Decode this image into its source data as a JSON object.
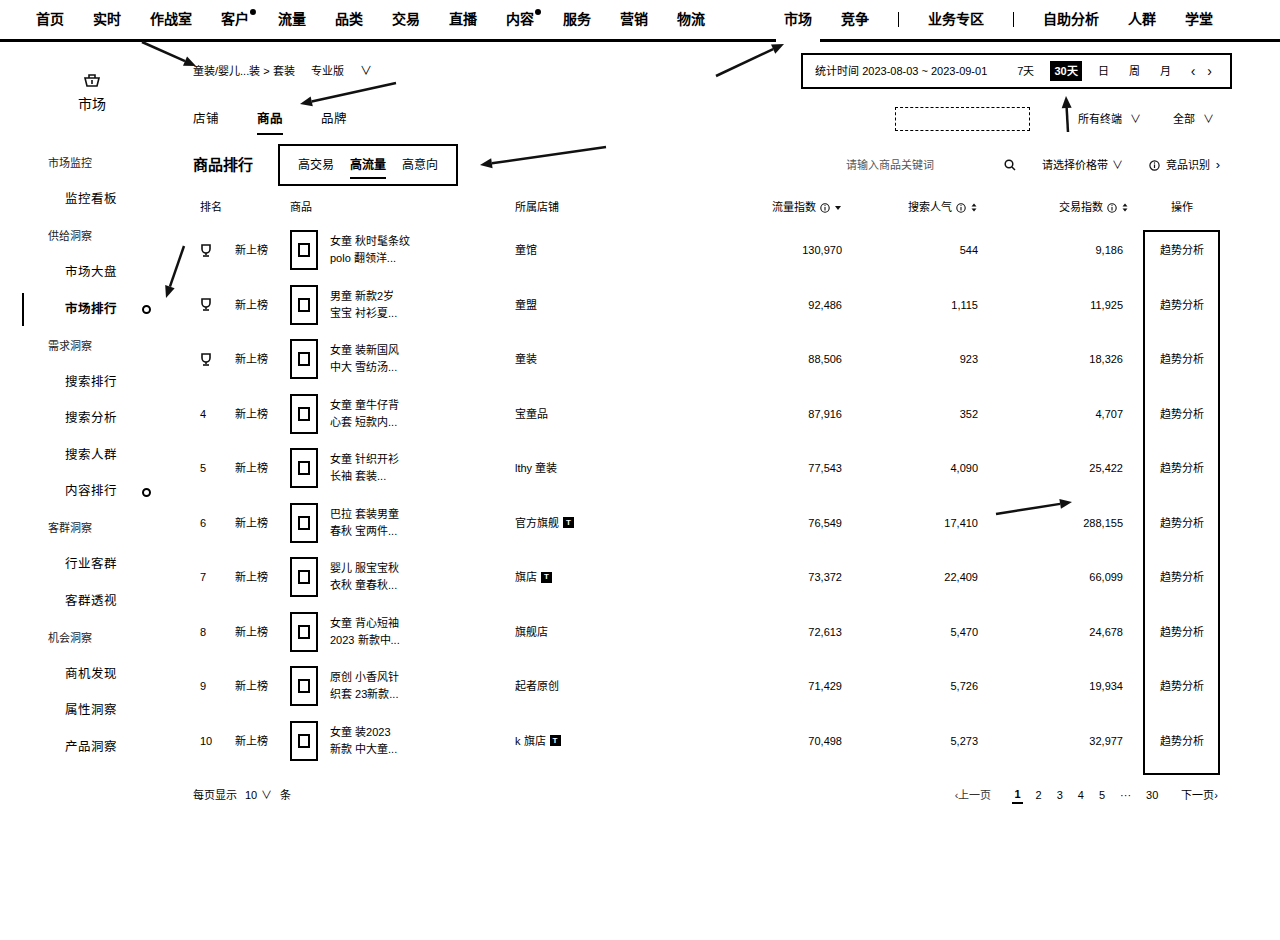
{
  "nav": [
    {
      "kind": "link",
      "label": "首页",
      "dot": false,
      "selected": false
    },
    {
      "kind": "link",
      "label": "实时",
      "dot": false,
      "selected": false
    },
    {
      "kind": "link",
      "label": "作战室",
      "dot": false,
      "selected": false
    },
    {
      "kind": "link",
      "label": "客户",
      "dot": true,
      "selected": false
    },
    {
      "kind": "link",
      "label": "流量",
      "dot": false,
      "selected": false
    },
    {
      "kind": "link",
      "label": "品类",
      "dot": false,
      "selected": false
    },
    {
      "kind": "link",
      "label": "交易",
      "dot": false,
      "selected": false
    },
    {
      "kind": "link",
      "label": "直播",
      "dot": false,
      "selected": false
    },
    {
      "kind": "link",
      "label": "内容",
      "dot": true,
      "selected": false
    },
    {
      "kind": "link",
      "label": "服务",
      "dot": false,
      "selected": false
    },
    {
      "kind": "link",
      "label": "营销",
      "dot": false,
      "selected": false
    },
    {
      "kind": "link",
      "label": "物流",
      "dot": false,
      "selected": false
    },
    {
      "kind": "link",
      "label": "市场",
      "dot": false,
      "selected": true
    },
    {
      "kind": "link",
      "label": "竞争",
      "dot": false,
      "selected": false
    },
    {
      "kind": "divider"
    },
    {
      "kind": "link",
      "label": "业务专区",
      "dot": false,
      "selected": false
    },
    {
      "kind": "divider"
    },
    {
      "kind": "link",
      "label": "自助分析",
      "dot": false,
      "selected": false
    },
    {
      "kind": "link",
      "label": "人群",
      "dot": false,
      "selected": false
    },
    {
      "kind": "link",
      "label": "学堂",
      "dot": false,
      "selected": false
    }
  ],
  "sidebar": {
    "title": "市场",
    "groups": [
      {
        "label": "市场监控",
        "items": [
          {
            "label": "监控看板",
            "selected": false,
            "marked": false
          }
        ]
      },
      {
        "label": "供给洞察",
        "items": [
          {
            "label": "市场大盘",
            "selected": false,
            "marked": false
          },
          {
            "label": "市场排行",
            "selected": true,
            "marked": true
          }
        ]
      },
      {
        "label": "需求洞察",
        "items": [
          {
            "label": "搜索排行",
            "selected": false,
            "marked": false
          },
          {
            "label": "搜索分析",
            "selected": false,
            "marked": false
          },
          {
            "label": "搜索人群",
            "selected": false,
            "marked": false
          },
          {
            "label": "内容排行",
            "selected": false,
            "marked": true
          }
        ]
      },
      {
        "label": "客群洞察",
        "items": [
          {
            "label": "行业客群",
            "selected": false,
            "marked": false
          },
          {
            "label": "客群透视",
            "selected": false,
            "marked": false
          }
        ]
      },
      {
        "label": "机会洞察",
        "items": [
          {
            "label": "商机发现",
            "selected": false,
            "marked": false
          },
          {
            "label": "属性洞察",
            "selected": false,
            "marked": false
          },
          {
            "label": "产品洞察",
            "selected": false,
            "marked": false
          }
        ]
      }
    ]
  },
  "breadcrumb": {
    "path": "童装/婴儿...装 > 套装",
    "edition": "专业版",
    "caret": "∨"
  },
  "date": {
    "label": "统计时间 2023-08-03 ~ 2023-09-01",
    "options": [
      {
        "label": "7天",
        "selected": false
      },
      {
        "label": "30天",
        "selected": true
      },
      {
        "label": "日",
        "selected": false
      },
      {
        "label": "周",
        "selected": false
      },
      {
        "label": "月",
        "selected": false
      }
    ],
    "prev": "‹",
    "next": "›"
  },
  "view_tabs": [
    {
      "label": "店铺",
      "selected": false
    },
    {
      "label": "商品",
      "selected": true
    },
    {
      "label": "品牌",
      "selected": false
    }
  ],
  "filters": {
    "terminal": "所有终端",
    "terminal_caret": "∨",
    "scope": "全部",
    "scope_caret": "∨"
  },
  "ranking": {
    "title": "商品排行",
    "tabs": [
      {
        "label": "高交易",
        "selected": false
      },
      {
        "label": "高流量",
        "selected": true
      },
      {
        "label": "高意向",
        "selected": false
      }
    ],
    "search_placeholder": "请输入商品关键词",
    "price": "请选择价格带",
    "price_caret": "∨",
    "competitor": "竞品识别",
    "competitor_arrow": "›"
  },
  "table": {
    "columns": [
      {
        "label": "排名",
        "info": false,
        "sort": "off"
      },
      {
        "label": "商品",
        "info": false,
        "sort": "off"
      },
      {
        "label": "所属店铺",
        "info": false,
        "sort": "off"
      },
      {
        "label": "流量指数",
        "info": true,
        "sort": "desc"
      },
      {
        "label": "搜索人气",
        "info": true,
        "sort": "none"
      },
      {
        "label": "交易指数",
        "info": true,
        "sort": "none"
      },
      {
        "label": "操作",
        "info": false,
        "sort": "off"
      }
    ],
    "rows": [
      {
        "kind": "trophy",
        "badge": "新上榜",
        "product": [
          "女童 秋时髦条纹",
          "polo 翻领洋..."
        ],
        "shop": "童馆",
        "shop_badge": "",
        "flow": "130,970",
        "search": "544",
        "trade": "9,186",
        "action": "趋势分析"
      },
      {
        "kind": "trophy",
        "badge": "新上榜",
        "product": [
          "男童 新款2岁",
          "宝宝 衬衫夏..."
        ],
        "shop": "童盟",
        "shop_badge": "",
        "flow": "92,486",
        "search": "1,115",
        "trade": "11,925",
        "action": "趋势分析"
      },
      {
        "kind": "trophy",
        "badge": "新上榜",
        "product": [
          "女童 装新国风",
          "中大 雪纺汤..."
        ],
        "shop": "童装",
        "shop_badge": "",
        "flow": "88,506",
        "search": "923",
        "trade": "18,326",
        "action": "趋势分析"
      },
      {
        "kind": "number",
        "rank": "4",
        "badge": "新上榜",
        "product": [
          "女童 童牛仔背",
          "心套 短款内..."
        ],
        "shop": "宝童品",
        "shop_badge": "",
        "flow": "87,916",
        "search": "352",
        "trade": "4,707",
        "action": "趋势分析"
      },
      {
        "kind": "number",
        "rank": "5",
        "badge": "新上榜",
        "product": [
          "女童 针织开衫",
          "长袖 套装..."
        ],
        "shop": "lthy 童装",
        "shop_badge": "",
        "flow": "77,543",
        "search": "4,090",
        "trade": "25,422",
        "action": "趋势分析"
      },
      {
        "kind": "number",
        "rank": "6",
        "badge": "新上榜",
        "product": [
          "巴拉 套装男童",
          "春秋 宝两件..."
        ],
        "shop": "官方旗舰",
        "shop_badge": "T",
        "flow": "76,549",
        "search": "17,410",
        "trade": "288,155",
        "action": "趋势分析"
      },
      {
        "kind": "number",
        "rank": "7",
        "badge": "新上榜",
        "product": [
          "婴儿 服宝宝秋",
          "衣秋 童春秋..."
        ],
        "shop": "旗店",
        "shop_badge": "T",
        "flow": "73,372",
        "search": "22,409",
        "trade": "66,099",
        "action": "趋势分析"
      },
      {
        "kind": "number",
        "rank": "8",
        "badge": "新上榜",
        "product": [
          "女童 背心短袖",
          "2023 新款中..."
        ],
        "shop": "旗舰店",
        "shop_badge": "",
        "flow": "72,613",
        "search": "5,470",
        "trade": "24,678",
        "action": "趋势分析"
      },
      {
        "kind": "number",
        "rank": "9",
        "badge": "新上榜",
        "product": [
          "原创 小香风针",
          "织套 23新款..."
        ],
        "shop": "起者原创",
        "shop_badge": "",
        "flow": "71,429",
        "search": "5,726",
        "trade": "19,934",
        "action": "趋势分析"
      },
      {
        "kind": "number",
        "rank": "10",
        "badge": "新上榜",
        "product": [
          "女童 装2023",
          "新款 中大童..."
        ],
        "shop": "k 旗店",
        "shop_badge": "T",
        "flow": "70,498",
        "search": "5,273",
        "trade": "32,977",
        "action": "趋势分析"
      }
    ]
  },
  "footer": {
    "per_page_label": "每页显示",
    "per_page": "10",
    "caret": "∨",
    "unit": "条"
  },
  "pagination": {
    "prev": "‹上一页",
    "pages": [
      {
        "label": "1",
        "selected": true
      },
      {
        "label": "2",
        "selected": false
      },
      {
        "label": "3",
        "selected": false
      },
      {
        "label": "4",
        "selected": false
      },
      {
        "label": "5",
        "selected": false
      },
      {
        "label": "···",
        "selected": false
      },
      {
        "label": "30",
        "selected": false
      }
    ],
    "next": "下一页›"
  }
}
